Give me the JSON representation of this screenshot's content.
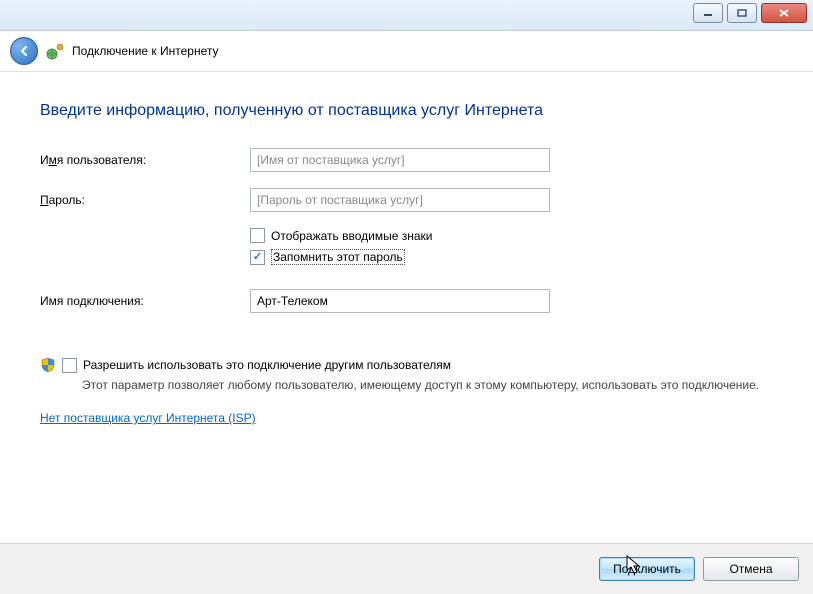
{
  "header": {
    "title": "Подключение к Интернету"
  },
  "main": {
    "heading": "Введите информацию, полученную от поставщика услуг Интернета",
    "username_label_pre": "И",
    "username_label_ul": "м",
    "username_label_post": "я пользователя:",
    "username_placeholder": "[Имя от поставщика услуг]",
    "password_label_ul": "П",
    "password_label_post": "ароль:",
    "password_placeholder": "[Пароль от поставщика услуг]",
    "show_chars_pre": "Отобра",
    "show_chars_ul": "ж",
    "show_chars_post": "ать вводимые знаки",
    "remember_ul": "З",
    "remember_post": "апомнить этот пароль",
    "conn_name_label": "Имя подключения:",
    "conn_name_value": "Арт-Телеком",
    "allow_ul": "Р",
    "allow_post": "азрешить использовать это подключение другим пользователям",
    "allow_desc": "Этот параметр позволяет любому пользователю, имеющему доступ к этому компьютеру, использовать это подключение.",
    "isp_link": "Нет поставщика услуг Интернета (ISP)"
  },
  "footer": {
    "connect": "Подключить",
    "cancel": "Отмена"
  }
}
